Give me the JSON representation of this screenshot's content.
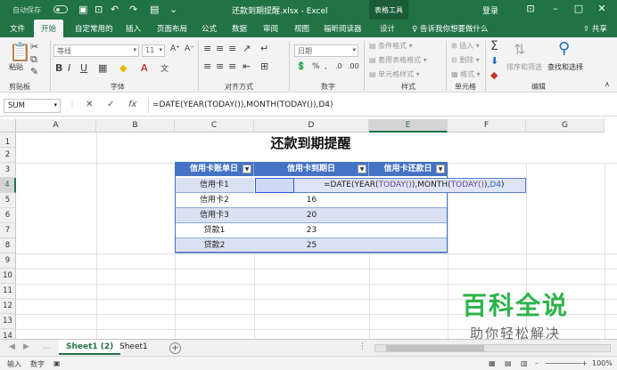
{
  "titlebar": {
    "autosave": "自动保存",
    "doc_title": "还款到期提醒.xlsx - Excel",
    "context_tools": "表格工具",
    "login": "登录"
  },
  "tabs": [
    "文件",
    "开始",
    "自定常用的",
    "插入",
    "页面布局",
    "公式",
    "数据",
    "审阅",
    "视图",
    "福昕阅读器",
    "设计"
  ],
  "active_tab": "开始",
  "tellme": "告诉我你想要做什么",
  "share": "共享",
  "ribbon": {
    "clipboard": {
      "paste": "粘贴",
      "label": "剪贴板"
    },
    "font": {
      "name": "等线",
      "size": "11",
      "label": "字体"
    },
    "align": {
      "label": "对齐方式"
    },
    "number": {
      "format": "日期",
      "label": "数字"
    },
    "styles": {
      "conditional": "条件格式",
      "table_format": "套用表格格式",
      "cell_style": "单元格样式",
      "label": "样式"
    },
    "cells": {
      "insert": "插入",
      "delete": "删除",
      "format": "格式",
      "label": "单元格"
    },
    "editing": {
      "sort": "排序和筛选",
      "find": "查找和选择",
      "label": "编辑"
    }
  },
  "formula_bar": {
    "name_box": "SUM",
    "formula": "=DATE(YEAR(TODAY()),MONTH(TODAY()),D4)"
  },
  "columns": [
    "A",
    "B",
    "C",
    "D",
    "E",
    "F",
    "G"
  ],
  "rows": [
    "1",
    "2",
    "3",
    "4",
    "5",
    "6",
    "7",
    "8",
    "9",
    "10",
    "11",
    "12",
    "13",
    "14"
  ],
  "sheet": {
    "title": "还款到期提醒",
    "headers": [
      "信用卡账单日",
      "信用卡到期日",
      "信用卡还款日"
    ],
    "table_rows": [
      {
        "name": "信用卡1",
        "due": ""
      },
      {
        "name": "信用卡2",
        "due": "16"
      },
      {
        "name": "信用卡3",
        "due": "20"
      },
      {
        "name": "贷款1",
        "due": "23"
      },
      {
        "name": "贷款2",
        "due": "25"
      }
    ],
    "editing_formula": {
      "p1": "=DATE(YEAR(",
      "p2": "TODAY()",
      "p3": "),MONTH(",
      "p4": "TODAY()",
      "p5": "),",
      "p6": "D4",
      "p7": ")"
    }
  },
  "sheet_tabs": [
    "Sheet1 (2)",
    "Sheet1"
  ],
  "active_sheet": "Sheet1 (2)",
  "status": {
    "mode": "输入",
    "numlock": "数字",
    "zoom": "100%"
  },
  "watermark": {
    "line1": "百科全说",
    "line2": "助你轻松解决"
  },
  "colors": {
    "excel_green": "#217346",
    "table_header": "#4472c4",
    "table_band": "#d9e1f2",
    "watermark_green": "#2db34a"
  }
}
